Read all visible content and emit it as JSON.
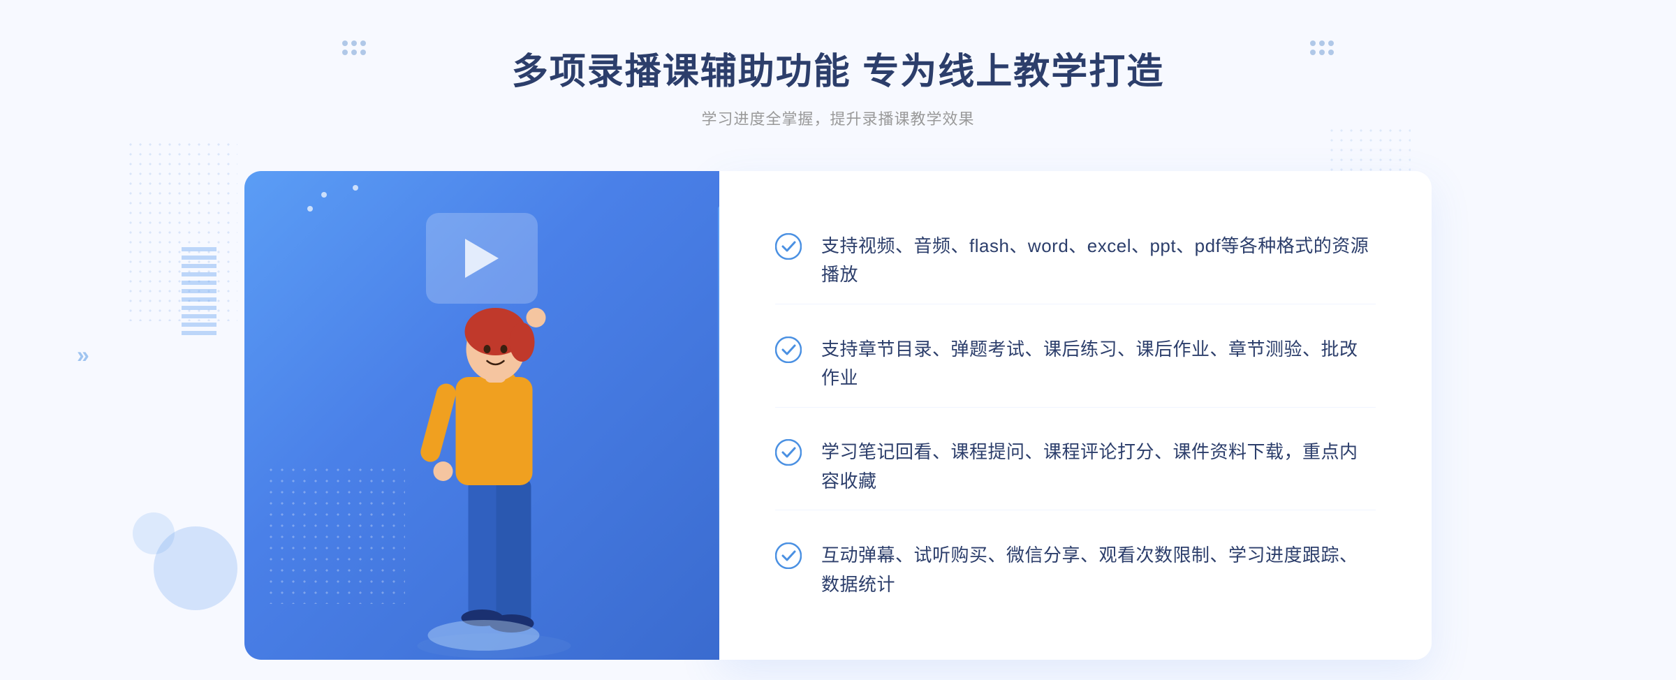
{
  "page": {
    "background_color": "#f7f9ff"
  },
  "header": {
    "main_title": "多项录播课辅助功能 专为线上教学打造",
    "sub_title": "学习进度全掌握，提升录播课教学效果"
  },
  "features": [
    {
      "id": 1,
      "text": "支持视频、音频、flash、word、excel、ppt、pdf等各种格式的资源播放"
    },
    {
      "id": 2,
      "text": "支持章节目录、弹题考试、课后练习、课后作业、章节测验、批改作业"
    },
    {
      "id": 3,
      "text": "学习笔记回看、课程提问、课程评论打分、课件资料下载，重点内容收藏"
    },
    {
      "id": 4,
      "text": "互动弹幕、试听购买、微信分享、观看次数限制、学习进度跟踪、数据统计"
    }
  ],
  "decorations": {
    "chevron_left": "»",
    "dots_icon": "✦"
  }
}
